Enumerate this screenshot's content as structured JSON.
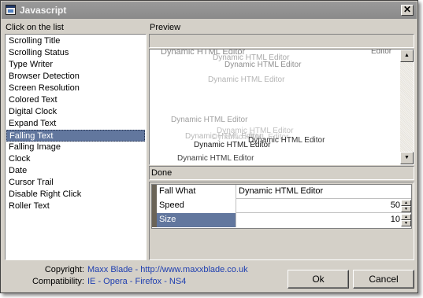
{
  "window": {
    "title": "Javascript",
    "close_glyph": "✕"
  },
  "labels": {
    "click_on_list": "Click on the list",
    "preview": "Preview"
  },
  "list": {
    "items": [
      "Scrolling Title",
      "Scrolling Status",
      "Type Writer",
      "Browser Detection",
      "Screen Resolution",
      "Colored Text",
      "Digital Clock",
      "Expand Text",
      "Falling Text",
      "Falling Image",
      "Clock",
      "Date",
      "Cursor Trail",
      "Disable Right Click",
      "Roller Text"
    ],
    "selected": "Falling Text"
  },
  "preview": {
    "texts": [
      "Dynamic HTML Editor",
      "Dynamic HTML Editor",
      "Dynamic HTML Editor",
      "Dynamic HTML Editor",
      "Dynamic HTML Editor",
      "Dynamic HTML Editor",
      "Dynamic HTML Editor",
      "Dynamic HTML Editor",
      "Dynamic HTML Editor",
      "Dynamic HTML Editor",
      "Dynamic HTML Editor",
      "Editor"
    ],
    "scroll_up": "▲",
    "scroll_down": "▼"
  },
  "status": "Done",
  "properties": {
    "rows": [
      {
        "key": "Fall What",
        "value": "Dynamic HTML Editor"
      },
      {
        "key": "Speed",
        "value": "50"
      },
      {
        "key": "Size",
        "value": "10"
      }
    ],
    "selected": "Size",
    "spin_up": "▲",
    "spin_down": "▼"
  },
  "footer": {
    "copyright_label": "Copyright:",
    "copyright_value": "Maxx Blade - http://www.maxxblade.co.uk",
    "compat_label": "Compatibility:",
    "compat_value": "IE - Opera - Firefox - NS4"
  },
  "buttons": {
    "ok": "Ok",
    "cancel": "Cancel"
  },
  "colors": {
    "selection": "#62779e",
    "link": "#1f3fb0",
    "face": "#d4d0c8",
    "preview_light": "#a9a9a9"
  },
  "icons": {
    "window": "app-window-icon",
    "close": "close-icon"
  }
}
